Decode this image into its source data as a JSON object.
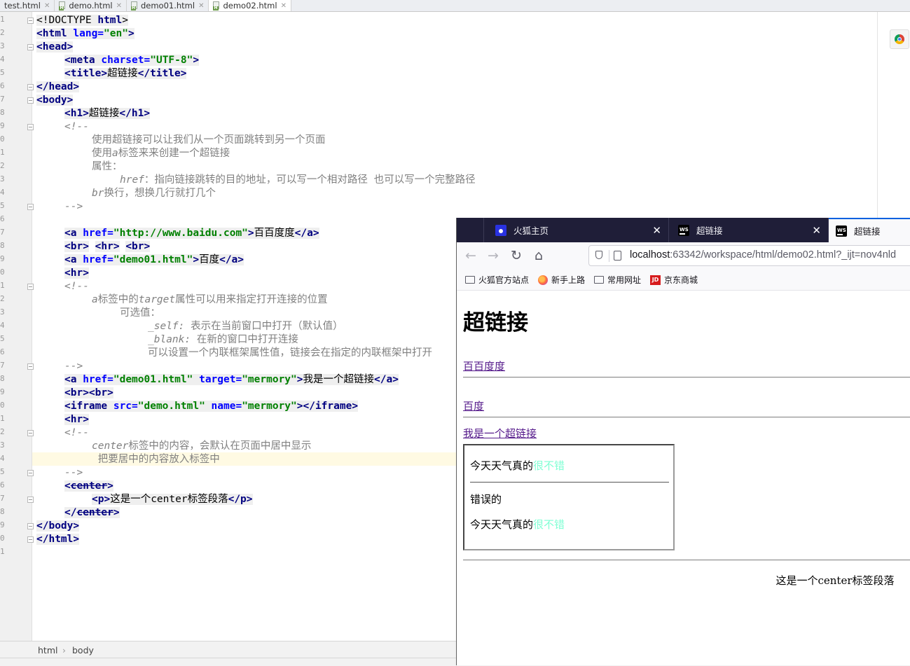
{
  "ide": {
    "tabs": [
      {
        "label": "test.html",
        "active": false
      },
      {
        "label": "demo.html",
        "active": false
      },
      {
        "label": "demo01.html",
        "active": false
      },
      {
        "label": "demo02.html",
        "active": true
      }
    ],
    "line_numbers": [
      "1",
      "2",
      "3",
      "4",
      "5",
      "6",
      "7",
      "8",
      "9",
      "0",
      "1",
      "2",
      "3",
      "4",
      "5",
      "6",
      "7",
      "8",
      "9",
      "0",
      "1",
      "2",
      "3",
      "4",
      "5",
      "6",
      "7",
      "8",
      "9",
      "0",
      "1",
      "2",
      "3",
      "4",
      "5",
      "6",
      "7",
      "8",
      "9",
      "0",
      "1"
    ],
    "code": {
      "doctype_open": "<!DOCTYPE ",
      "doctype_html": "html",
      "doctype_close": ">",
      "html_open": "<html ",
      "lang_attr": "lang=",
      "lang_val": "\"en\"",
      "gt": ">",
      "head_open": "<head>",
      "meta_open": "<meta ",
      "charset_attr": "charset=",
      "charset_val": "\"UTF-8\"",
      "title_open": "<title>",
      "title_text": "超链接",
      "title_close": "</title>",
      "head_close": "</head>",
      "body_open": "<body>",
      "h1_open": "<h1>",
      "h1_text": "超链接",
      "h1_close": "</h1>",
      "comment_open": "<!--",
      "comment_close": "-->",
      "c1_l1": "使用超链接可以让我们从一个页面跳转到另一个页面",
      "c1_l2a": "使用",
      "c1_l2b": "a",
      "c1_l2c": "标签来来创建一个超链接",
      "c1_l3": "属性：",
      "c1_l4a": "href",
      "c1_l4b": "：指向链接跳转的目的地址，可以写一个相对路径 也可以写一个完整路径",
      "c1_l5a": "br",
      "c1_l5b": "换行，想换几行就打几个",
      "a_open": "<a ",
      "href_attr": "href=",
      "href_baidu": "\"http://www.baidu.com\"",
      "baidu_text": "百百度度",
      "a_close": "</a>",
      "br_hr_br_1": "<br>",
      "br_hr_br_2": "<hr>",
      "br_hr_br_3": "<br>",
      "href_demo01": "\"demo01.html\"",
      "baidu2_text": "百度",
      "hr": "<hr>",
      "c2_l1a": "a",
      "c2_l1b": "标签中的",
      "c2_l1c": "target",
      "c2_l1d": "属性可以用来指定打开连接的位置",
      "c2_l2": "可选值：",
      "c2_l3a": "_self: ",
      "c2_l3b": "表示在当前窗口中打开（默认值）",
      "c2_l4a": "_blank: ",
      "c2_l4b": "在新的窗口中打开连接",
      "c2_l5": "可以设置一个内联框架属性值，链接会在指定的内联框架中打开",
      "target_attr": "target=",
      "target_val": "\"mermory\"",
      "link3_text": "我是一个超链接",
      "brbr": "<br><br>",
      "iframe_open": "<iframe ",
      "src_attr": "src=",
      "src_val": "\"demo.html\"",
      "name_attr": "name=",
      "name_val": "\"mermory\"",
      "iframe_close": "></iframe>",
      "c3_l1a": "center",
      "c3_l1b": "标签中的内容，会默认在页面中居中显示",
      "c3_l2": " 把要居中的内容放入标签中",
      "center_open_lt": "<",
      "center_word": "center",
      "center_open_gt": ">",
      "p_open": "<p>",
      "p_text": "这是一个center标签段落",
      "p_close": "</p>",
      "center_close_lt": "</",
      "center_close_gt": ">",
      "body_close": "</body>",
      "html_close": "</html>"
    },
    "breadcrumb": [
      "html",
      "body"
    ]
  },
  "browser": {
    "tabs": [
      {
        "label": "火狐主页",
        "icon": "baidu-paw-icon"
      },
      {
        "label": "超链接",
        "icon": "webstorm-icon"
      },
      {
        "label": "超链接",
        "icon": "webstorm-icon",
        "active": true
      }
    ],
    "url_host": "localhost",
    "url_rest": ":63342/workspace/html/demo02.html?_ijt=nov4nld",
    "bookmarks": [
      "火狐官方站点",
      "新手上路",
      "常用网址",
      "京东商城"
    ],
    "page": {
      "h1": "超链接",
      "link1": "百百度度",
      "link2": "百度",
      "link3": "我是一个超链接",
      "iframe": {
        "line1_prefix": "今天天气真的",
        "line1_green": "很不错",
        "line2": "错误的",
        "line3_prefix": "今天天气真的",
        "line3_green": "很不错"
      },
      "center_paragraph": "这是一个center标签段落"
    }
  },
  "colors": {
    "tag": "#000080",
    "attr": "#0000ff",
    "value": "#008000",
    "comment": "#808080",
    "visited_link": "#551a8b",
    "iframe_green": "#7fffd4",
    "firefox_tabbar": "#1f1e38"
  }
}
